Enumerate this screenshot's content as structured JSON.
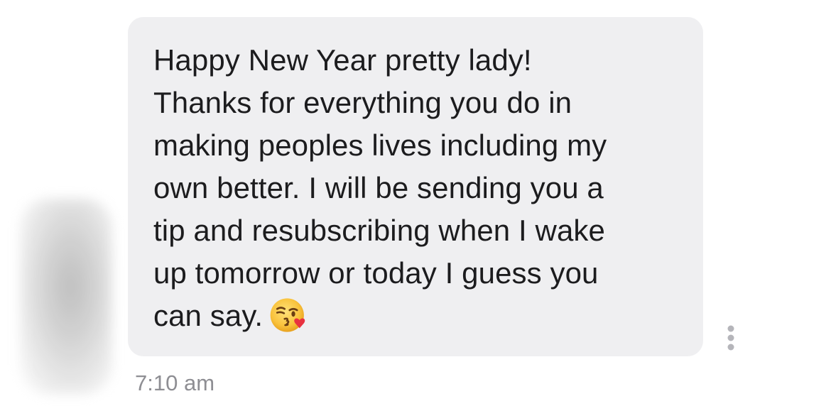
{
  "message": {
    "text": "Happy New Year pretty lady!\nThanks for everything you do in\nmaking peoples lives including my\nown better. I will be sending you a\ntip and resubscribing when I wake\nup tomorrow or today I guess you\ncan say.",
    "emoji": "kissing-face-with-heart-emoji",
    "timestamp": "7:10 am",
    "bubble_color": "#efeff1",
    "text_color": "#1c1c1e"
  },
  "icons": {
    "more_options": "vertical-ellipsis-icon",
    "avatar": "blurred-avatar"
  },
  "colors": {
    "timestamp": "#8e8e93",
    "icon_gray": "#b5b5ba"
  }
}
